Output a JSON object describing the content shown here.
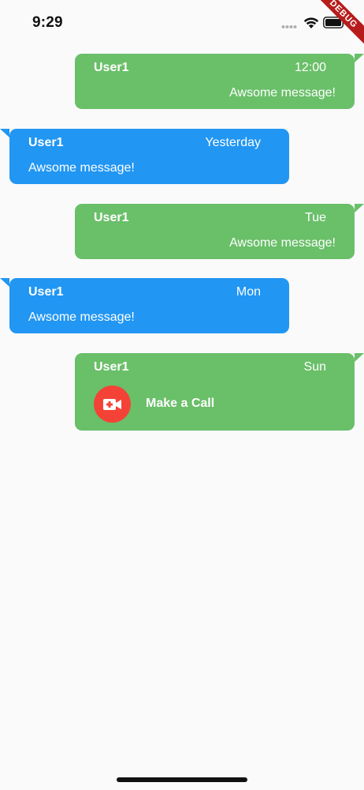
{
  "status_bar": {
    "time": "9:29"
  },
  "debug_banner": {
    "label": "DEBUG"
  },
  "colors": {
    "sent_bubble": "#6abf69",
    "received_bubble": "#2196f3",
    "call_button": "#f44336",
    "background": "#fafafa"
  },
  "messages": [
    {
      "direction": "sent",
      "sender": "User1",
      "time": "12:00",
      "text": "Awsome message!"
    },
    {
      "direction": "received",
      "sender": "User1",
      "time": "Yesterday",
      "text": "Awsome message!"
    },
    {
      "direction": "sent",
      "sender": "User1",
      "time": "Tue",
      "text": "Awsome message!"
    },
    {
      "direction": "received",
      "sender": "User1",
      "time": "Mon",
      "text": "Awsome message!"
    },
    {
      "direction": "sent",
      "sender": "User1",
      "time": "Sun",
      "call_label": "Make a Call",
      "icon": "video-call-icon"
    }
  ]
}
